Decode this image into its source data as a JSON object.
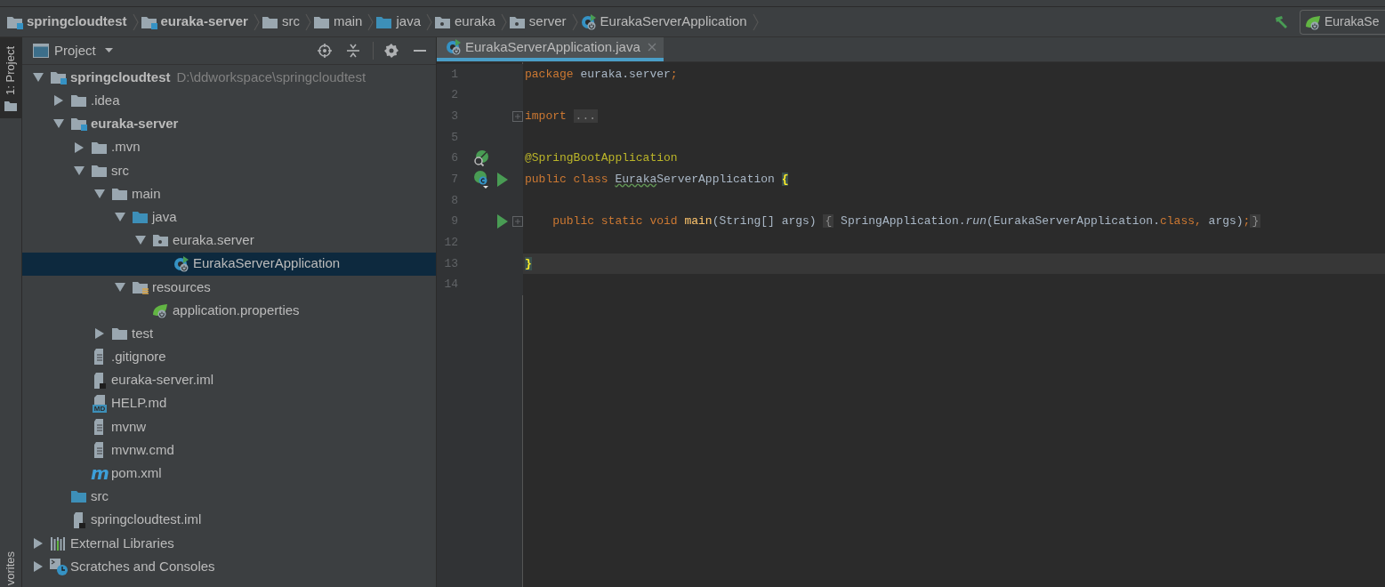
{
  "breadcrumbs": [
    {
      "label": "springcloudtest",
      "kind": "module"
    },
    {
      "label": "euraka-server",
      "kind": "module"
    },
    {
      "label": "src",
      "kind": "folder"
    },
    {
      "label": "main",
      "kind": "folder"
    },
    {
      "label": "java",
      "kind": "source_folder"
    },
    {
      "label": "euraka",
      "kind": "package"
    },
    {
      "label": "server",
      "kind": "package"
    },
    {
      "label": "EurakaServerApplication",
      "kind": "spring_class"
    }
  ],
  "run_config": {
    "label": "EurakaSe"
  },
  "tool_stripe": {
    "top_tab": {
      "label": "1: Project",
      "selected": true
    },
    "bottom_tab": {
      "label": "vorites"
    }
  },
  "project_panel": {
    "title": "Project",
    "tree": [
      {
        "label": "springcloudtest",
        "kind": "module",
        "path": "D:\\ddworkspace\\springcloudtest",
        "expanded": true,
        "selected": false,
        "children": [
          {
            "label": ".idea",
            "kind": "folder",
            "expanded": false,
            "selected": false
          },
          {
            "label": "euraka-server",
            "kind": "module",
            "expanded": true,
            "selected": false,
            "children": [
              {
                "label": ".mvn",
                "kind": "folder",
                "expanded": false,
                "selected": false
              },
              {
                "label": "src",
                "kind": "folder",
                "expanded": true,
                "selected": false,
                "children": [
                  {
                    "label": "main",
                    "kind": "folder",
                    "expanded": true,
                    "selected": false,
                    "children": [
                      {
                        "label": "java",
                        "kind": "source_folder",
                        "expanded": true,
                        "selected": false,
                        "children": [
                          {
                            "label": "euraka.server",
                            "kind": "package",
                            "expanded": true,
                            "selected": false,
                            "children": [
                              {
                                "label": "EurakaServerApplication",
                                "kind": "spring_class",
                                "selected": true
                              }
                            ]
                          }
                        ]
                      },
                      {
                        "label": "resources",
                        "kind": "resources",
                        "expanded": true,
                        "selected": false,
                        "children": [
                          {
                            "label": "application.properties",
                            "kind": "spring_props",
                            "selected": false
                          }
                        ]
                      }
                    ]
                  },
                  {
                    "label": "test",
                    "kind": "folder",
                    "expanded": false,
                    "selected": false
                  }
                ]
              },
              {
                "label": ".gitignore",
                "kind": "text_file",
                "selected": false
              },
              {
                "label": "euraka-server.iml",
                "kind": "iml",
                "selected": false
              },
              {
                "label": "HELP.md",
                "kind": "md",
                "icon_text": "MD",
                "selected": false
              },
              {
                "label": "mvnw",
                "kind": "text_file",
                "selected": false
              },
              {
                "label": "mvnw.cmd",
                "kind": "text_file",
                "selected": false
              },
              {
                "label": "pom.xml",
                "kind": "maven",
                "icon_text": "m",
                "selected": false
              }
            ]
          },
          {
            "label": "src",
            "kind": "source_folder",
            "selected": false
          },
          {
            "label": "springcloudtest.iml",
            "kind": "iml",
            "selected": false
          }
        ]
      },
      {
        "label": "External Libraries",
        "kind": "libraries",
        "expanded": false,
        "selected": false
      },
      {
        "label": "Scratches and Consoles",
        "kind": "scratches",
        "expanded": false,
        "selected": false
      }
    ]
  },
  "editor": {
    "tabs": [
      {
        "label": "EurakaServerApplication.java",
        "kind": "spring_class",
        "selected": true
      }
    ],
    "lines": [
      {
        "number": "1",
        "current": false,
        "fold": false,
        "tokens": [
          {
            "text": "package ",
            "kind": "keyword"
          },
          {
            "text": "euraka.server",
            "kind": "plain"
          },
          {
            "text": ";",
            "kind": "keyword"
          }
        ]
      },
      {
        "number": "2",
        "current": false,
        "fold": false
      },
      {
        "number": "3",
        "current": false,
        "fold": true,
        "tokens": [
          {
            "text": "import ",
            "kind": "keyword"
          },
          {
            "text": "...",
            "kind": "folded"
          }
        ]
      },
      {
        "number": "5",
        "current": false,
        "fold": false
      },
      {
        "number": "6",
        "current": false,
        "fold": false,
        "markers": [
          {
            "kind": "bean"
          }
        ],
        "tokens": [
          {
            "text": "@SpringBootApplication",
            "kind": "annotation"
          }
        ]
      },
      {
        "number": "7",
        "current": false,
        "fold": false,
        "markers": [
          {
            "kind": "spring_class"
          },
          {
            "kind": "run"
          }
        ],
        "tokens": [
          {
            "text": "public class ",
            "kind": "keyword"
          },
          {
            "text": "Euraka",
            "kind": "typo"
          },
          {
            "text": "ServerApplication ",
            "kind": "plain"
          },
          {
            "text": "{",
            "kind": "brace_match"
          }
        ]
      },
      {
        "number": "8",
        "current": false,
        "fold": false
      },
      {
        "number": "9",
        "current": false,
        "fold": true,
        "markers": [
          {
            "kind": "run"
          }
        ],
        "tokens": [
          {
            "text": "    public static void ",
            "kind": "keyword"
          },
          {
            "text": "main",
            "kind": "method"
          },
          {
            "text": "(String[] args) ",
            "kind": "plain"
          },
          {
            "text": "{",
            "kind": "folded"
          },
          {
            "text": " SpringApplication.",
            "kind": "plain"
          },
          {
            "text": "run",
            "kind": "call"
          },
          {
            "text": "(EurakaServerApplication.",
            "kind": "plain"
          },
          {
            "text": "class, ",
            "kind": "keyword"
          },
          {
            "text": "args)",
            "kind": "plain"
          },
          {
            "text": ";",
            "kind": "keyword"
          },
          {
            "text": "}",
            "kind": "folded"
          }
        ]
      },
      {
        "number": "12",
        "current": false,
        "fold": false
      },
      {
        "number": "13",
        "current": true,
        "fold": false,
        "tokens": [
          {
            "text": "}",
            "kind": "brace_match"
          }
        ]
      },
      {
        "number": "14",
        "current": false,
        "fold": false
      }
    ]
  }
}
